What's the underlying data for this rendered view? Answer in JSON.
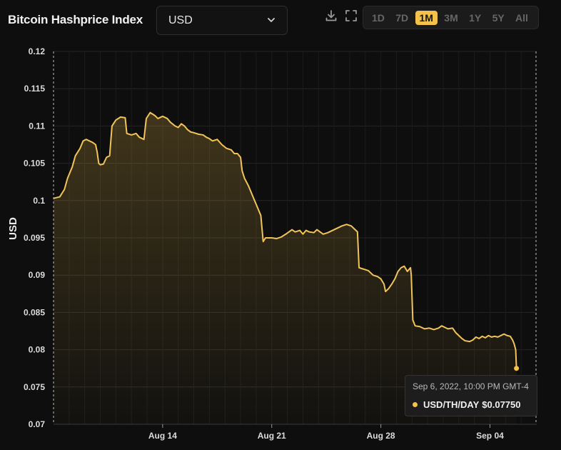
{
  "header": {
    "title": "Bitcoin Hashprice Index",
    "currency": "USD",
    "icons": [
      "download-icon",
      "fullscreen-icon",
      "chevron-down-icon"
    ],
    "ranges": [
      "1D",
      "7D",
      "1M",
      "3M",
      "1Y",
      "5Y",
      "All"
    ],
    "active_range": "1M"
  },
  "colors": {
    "accent": "#f4c24b",
    "line": "#f1c45a",
    "background": "#0e0e0e",
    "grid": "#262626"
  },
  "tooltip": {
    "date": "Sep 6, 2022, 10:00 PM GMT-4",
    "label": "USD/TH/DAY",
    "value": "$0.07750"
  },
  "chart_data": {
    "type": "area",
    "ylabel": "USD",
    "xlabel": "",
    "ylim": [
      0.07,
      0.12
    ],
    "yticks": [
      "0.12",
      "0.115",
      "0.11",
      "0.105",
      "0.1",
      "0.095",
      "0.09",
      "0.085",
      "0.08",
      "0.075",
      "0.07"
    ],
    "xlim": [
      0,
      31
    ],
    "xticks": [
      {
        "x": 7,
        "label": "Aug 14"
      },
      {
        "x": 14,
        "label": "Aug 21"
      },
      {
        "x": 21,
        "label": "Aug 28"
      },
      {
        "x": 28,
        "label": "Sep 04"
      }
    ],
    "grid": true,
    "x_unit": "days from Aug 7, 2022",
    "series": [
      {
        "values": [
          [
            0.0,
            0.1003
          ],
          [
            0.4,
            0.1005
          ],
          [
            0.7,
            0.1015
          ],
          [
            0.9,
            0.103
          ],
          [
            1.2,
            0.1045
          ],
          [
            1.4,
            0.106
          ],
          [
            1.7,
            0.107
          ],
          [
            1.9,
            0.108
          ],
          [
            2.1,
            0.1082
          ],
          [
            2.3,
            0.108
          ],
          [
            2.5,
            0.1078
          ],
          [
            2.7,
            0.1075
          ],
          [
            2.8,
            0.1065
          ],
          [
            2.9,
            0.105
          ],
          [
            3.0,
            0.1048
          ],
          [
            3.2,
            0.1049
          ],
          [
            3.4,
            0.1058
          ],
          [
            3.6,
            0.106
          ],
          [
            3.75,
            0.11
          ],
          [
            4.0,
            0.1108
          ],
          [
            4.3,
            0.1112
          ],
          [
            4.6,
            0.1111
          ],
          [
            4.7,
            0.109
          ],
          [
            5.0,
            0.1088
          ],
          [
            5.3,
            0.109
          ],
          [
            5.5,
            0.1085
          ],
          [
            5.8,
            0.1082
          ],
          [
            5.95,
            0.111
          ],
          [
            6.2,
            0.1118
          ],
          [
            6.5,
            0.1114
          ],
          [
            6.7,
            0.111
          ],
          [
            7.0,
            0.1113
          ],
          [
            7.3,
            0.111
          ],
          [
            7.5,
            0.1105
          ],
          [
            7.8,
            0.11
          ],
          [
            8.0,
            0.1098
          ],
          [
            8.2,
            0.1103
          ],
          [
            8.4,
            0.11
          ],
          [
            8.6,
            0.1095
          ],
          [
            8.8,
            0.1092
          ],
          [
            9.0,
            0.1091
          ],
          [
            9.3,
            0.1089
          ],
          [
            9.6,
            0.1088
          ],
          [
            9.8,
            0.1085
          ],
          [
            10.0,
            0.1083
          ],
          [
            10.2,
            0.108
          ],
          [
            10.5,
            0.1082
          ],
          [
            10.8,
            0.1075
          ],
          [
            11.1,
            0.107
          ],
          [
            11.4,
            0.1068
          ],
          [
            11.6,
            0.1063
          ],
          [
            11.8,
            0.1063
          ],
          [
            12.0,
            0.1058
          ],
          [
            12.1,
            0.104
          ],
          [
            12.25,
            0.103
          ],
          [
            12.5,
            0.102
          ],
          [
            12.8,
            0.1005
          ],
          [
            13.1,
            0.099
          ],
          [
            13.3,
            0.098
          ],
          [
            13.45,
            0.0945
          ],
          [
            13.6,
            0.095
          ],
          [
            14.0,
            0.095
          ],
          [
            14.3,
            0.0949
          ],
          [
            14.6,
            0.0951
          ],
          [
            14.9,
            0.0955
          ],
          [
            15.1,
            0.0958
          ],
          [
            15.3,
            0.0961
          ],
          [
            15.5,
            0.0958
          ],
          [
            15.8,
            0.096
          ],
          [
            16.0,
            0.0955
          ],
          [
            16.2,
            0.096
          ],
          [
            16.4,
            0.0958
          ],
          [
            16.7,
            0.0957
          ],
          [
            16.9,
            0.0961
          ],
          [
            17.1,
            0.0958
          ],
          [
            17.3,
            0.0955
          ],
          [
            17.6,
            0.0957
          ],
          [
            17.9,
            0.096
          ],
          [
            18.2,
            0.0963
          ],
          [
            18.5,
            0.0966
          ],
          [
            18.8,
            0.0968
          ],
          [
            19.1,
            0.0966
          ],
          [
            19.3,
            0.0962
          ],
          [
            19.5,
            0.0958
          ],
          [
            19.6,
            0.091
          ],
          [
            19.9,
            0.0908
          ],
          [
            20.2,
            0.0906
          ],
          [
            20.5,
            0.09
          ],
          [
            20.8,
            0.0898
          ],
          [
            21.0,
            0.0895
          ],
          [
            21.2,
            0.0888
          ],
          [
            21.3,
            0.0878
          ],
          [
            21.5,
            0.0882
          ],
          [
            21.7,
            0.0888
          ],
          [
            21.9,
            0.0895
          ],
          [
            22.1,
            0.0905
          ],
          [
            22.3,
            0.091
          ],
          [
            22.5,
            0.0912
          ],
          [
            22.7,
            0.0905
          ],
          [
            22.9,
            0.091
          ],
          [
            22.95,
            0.09
          ],
          [
            23.05,
            0.084
          ],
          [
            23.2,
            0.0832
          ],
          [
            23.5,
            0.0831
          ],
          [
            23.8,
            0.0828
          ],
          [
            24.1,
            0.0829
          ],
          [
            24.4,
            0.0827
          ],
          [
            24.7,
            0.0829
          ],
          [
            24.9,
            0.0832
          ],
          [
            25.1,
            0.083
          ],
          [
            25.3,
            0.0828
          ],
          [
            25.6,
            0.0829
          ],
          [
            25.8,
            0.0823
          ],
          [
            26.0,
            0.0819
          ],
          [
            26.2,
            0.0815
          ],
          [
            26.4,
            0.0812
          ],
          [
            26.7,
            0.0811
          ],
          [
            26.9,
            0.0813
          ],
          [
            27.1,
            0.0817
          ],
          [
            27.3,
            0.0815
          ],
          [
            27.5,
            0.0818
          ],
          [
            27.7,
            0.0816
          ],
          [
            27.9,
            0.0819
          ],
          [
            28.1,
            0.0817
          ],
          [
            28.3,
            0.0818
          ],
          [
            28.5,
            0.0817
          ],
          [
            28.7,
            0.0819
          ],
          [
            28.9,
            0.0821
          ],
          [
            29.1,
            0.0819
          ],
          [
            29.3,
            0.0818
          ],
          [
            29.45,
            0.0813
          ],
          [
            29.55,
            0.0808
          ],
          [
            29.65,
            0.08
          ],
          [
            29.7,
            0.0775
          ]
        ]
      }
    ]
  }
}
